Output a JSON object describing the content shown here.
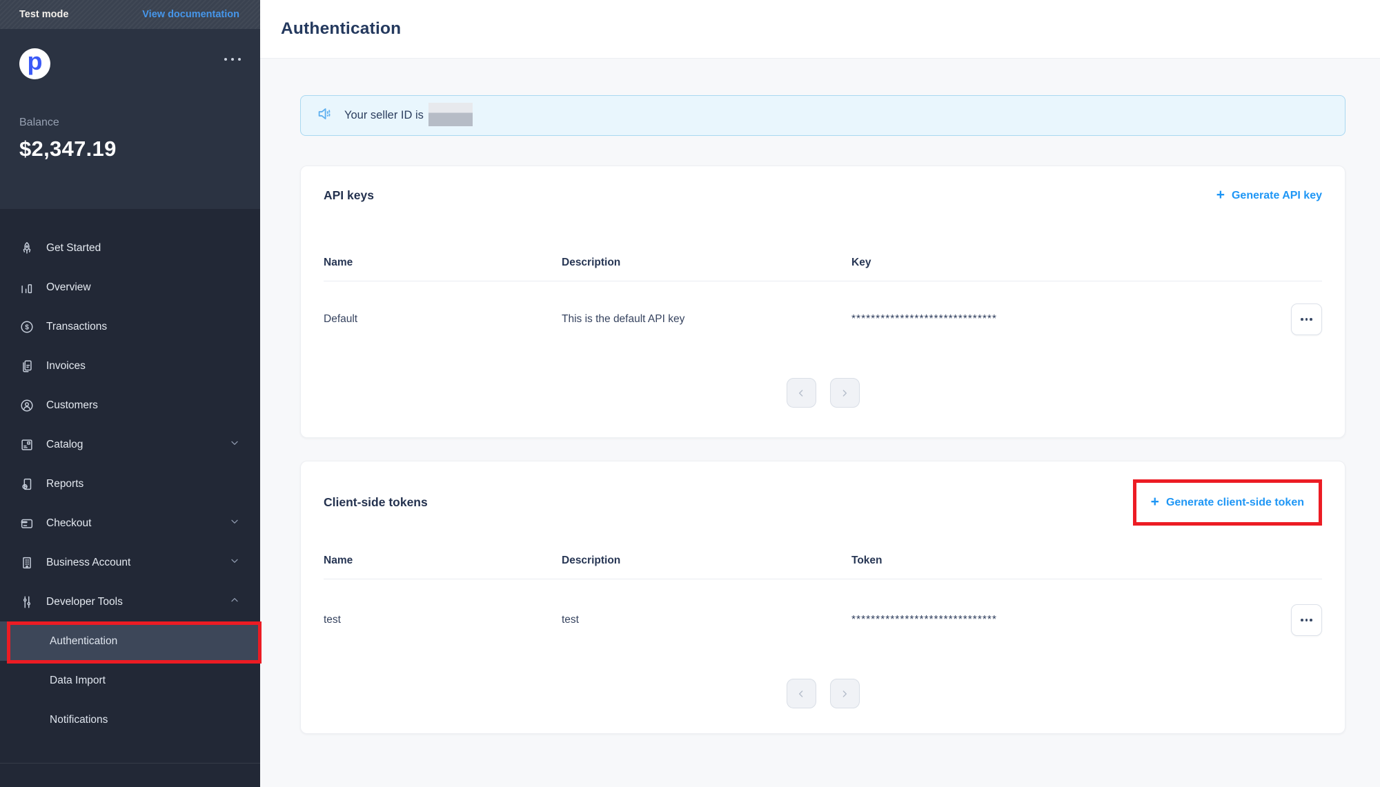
{
  "topbar": {
    "test_mode": "Test mode",
    "view_documentation": "View documentation"
  },
  "sidebar": {
    "logo_letter": "p",
    "balance_label": "Balance",
    "balance_value": "$2,347.19",
    "items": [
      {
        "label": "Get Started",
        "icon": "rocket-icon"
      },
      {
        "label": "Overview",
        "icon": "bar-chart-icon"
      },
      {
        "label": "Transactions",
        "icon": "dollar-circle-icon"
      },
      {
        "label": "Invoices",
        "icon": "invoice-icon"
      },
      {
        "label": "Customers",
        "icon": "customer-icon"
      },
      {
        "label": "Catalog",
        "icon": "box-icon",
        "chevron": "down"
      },
      {
        "label": "Reports",
        "icon": "report-icon"
      },
      {
        "label": "Checkout",
        "icon": "credit-card-icon",
        "chevron": "down"
      },
      {
        "label": "Business Account",
        "icon": "building-icon",
        "chevron": "down"
      },
      {
        "label": "Developer Tools",
        "icon": "sliders-icon",
        "chevron": "up",
        "expanded": true
      }
    ],
    "subitems": [
      {
        "label": "Authentication",
        "active": true,
        "annotated": true
      },
      {
        "label": "Data Import"
      },
      {
        "label": "Notifications"
      }
    ]
  },
  "header": {
    "title": "Authentication"
  },
  "banner": {
    "icon": "megaphone-icon",
    "text": "Your seller ID is",
    "seller_id_redacted": true
  },
  "cards": [
    {
      "title": "API keys",
      "action_plus": "+",
      "action_label": "Generate API key",
      "columns": [
        "Name",
        "Description",
        "Key"
      ],
      "rows": [
        {
          "name": "Default",
          "description": "This is the default API key",
          "secret": "******************************"
        }
      ]
    },
    {
      "title": "Client-side tokens",
      "action_plus": "+",
      "action_label": "Generate client-side token",
      "action_annotated": true,
      "columns": [
        "Name",
        "Description",
        "Token"
      ],
      "rows": [
        {
          "name": "test",
          "description": "test",
          "secret": "******************************"
        }
      ]
    }
  ],
  "colors": {
    "accent_blue": "#1e96f5",
    "link_blue": "#4696ea",
    "annotation_red": "#ec1c24",
    "sidebar_bg": "#222836",
    "sidebar_top_bg": "#2b3342",
    "active_item_bg": "#3d4759",
    "banner_bg": "#e9f6fd",
    "banner_border": "#a9d8f1",
    "title_navy": "#24395e"
  }
}
